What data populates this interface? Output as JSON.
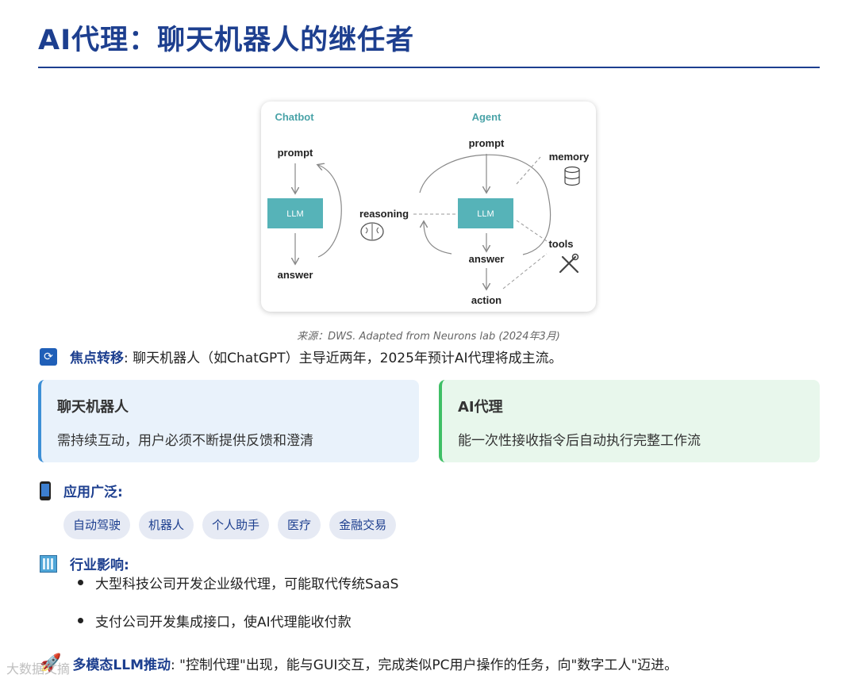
{
  "title": "AI代理：聊天机器人的继任者",
  "diagram": {
    "chatbot_heading": "Chatbot",
    "agent_heading": "Agent",
    "chatbot_prompt": "prompt",
    "chatbot_llm": "LLM",
    "chatbot_answer": "answer",
    "agent_prompt": "prompt",
    "agent_llm": "LLM",
    "agent_answer": "answer",
    "agent_action": "action",
    "reasoning": "reasoning",
    "memory": "memory",
    "tools": "tools",
    "colors": {
      "heading": "#4aa3a8",
      "llm_box": "#56b3b8",
      "llm_text": "#ffffff"
    }
  },
  "caption": "来源：DWS. Adapted from Neurons lab (2024年3月)",
  "focus": {
    "icon": "refresh-icon",
    "label": "焦点转移",
    "text": ": 聊天机器人（如ChatGPT）主导近两年，2025年预计AI代理将成主流。"
  },
  "cards": [
    {
      "title": "聊天机器人",
      "text": "需持续互动，用户必须不断提供反馈和澄清"
    },
    {
      "title": "AI代理",
      "text": "能一次性接收指令后自动执行完整工作流"
    }
  ],
  "applications": {
    "icon": "mobile-phone-icon",
    "label": "应用广泛:",
    "tags": [
      "自动驾驶",
      "机器人",
      "个人助手",
      "医疗",
      "金融交易"
    ]
  },
  "industry": {
    "icon": "office-building-icon",
    "label": "行业影响:",
    "bullets": [
      "大型科技公司开发企业级代理，可能取代传统SaaS",
      "支付公司开发集成接口，使AI代理能收付款"
    ]
  },
  "multimodal": {
    "icon": "rocket-icon",
    "label": "多模态LLM推动",
    "text": ": \"控制代理\"出现，能与GUI交互，完成类似PC用户操作的任务，向\"数字工人\"迈进。"
  },
  "watermark": "大数据文摘"
}
